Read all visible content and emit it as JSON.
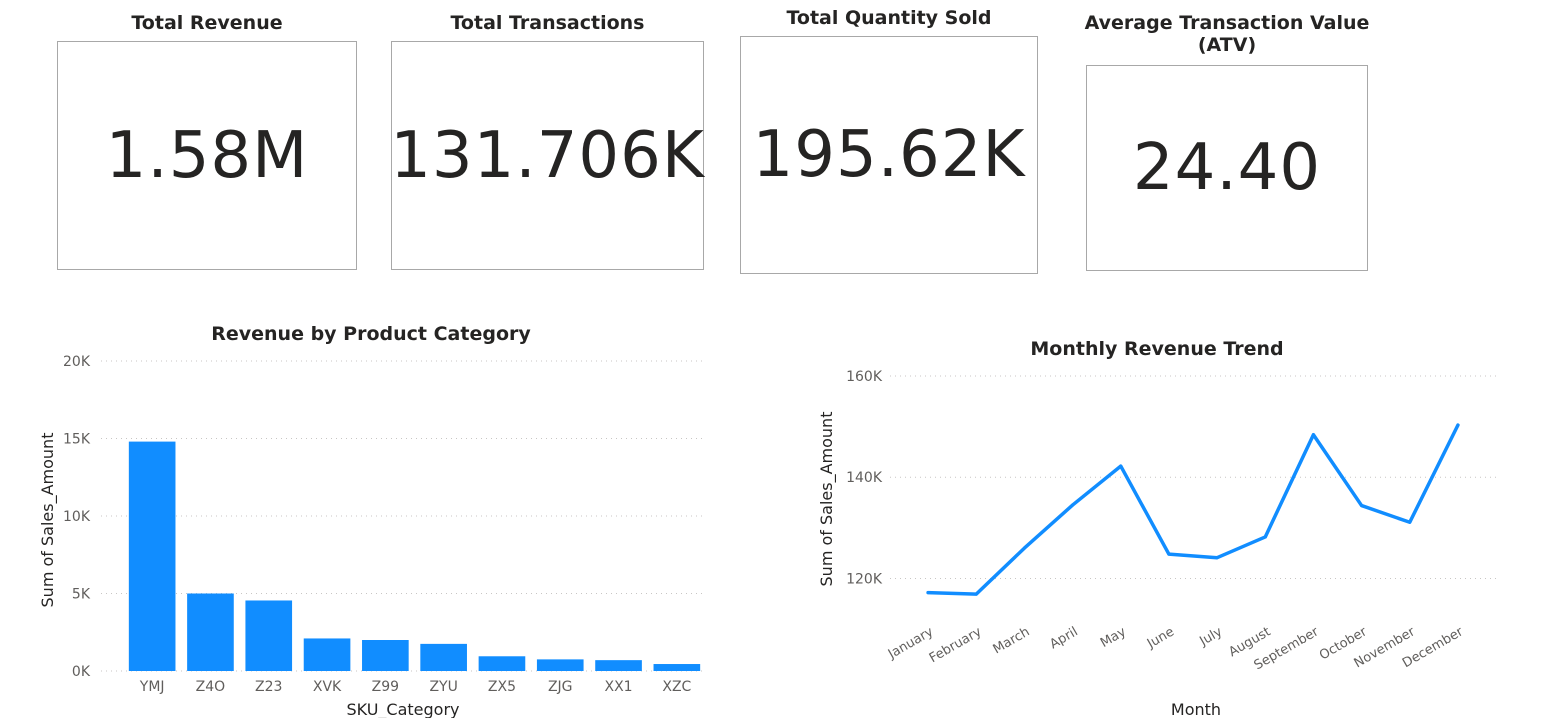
{
  "kpis": [
    {
      "title": "Total Revenue",
      "value": "1.58M"
    },
    {
      "title": "Total Transactions",
      "value": "131.706K"
    },
    {
      "title": "Total Quantity Sold",
      "value": "195.62K"
    },
    {
      "title": "Average Transaction Value\n(ATV)",
      "value": "24.40"
    }
  ],
  "colors": {
    "series": "#118DFF",
    "grid": "#c8c6c4",
    "text": "#252423",
    "axis_text": "#605e5c"
  },
  "chart_data": [
    {
      "type": "bar",
      "title": "Revenue by Product Category",
      "xlabel": "SKU_Category",
      "ylabel": "Sum of Sales_Amount",
      "categories": [
        "YMJ",
        "Z4O",
        "Z23",
        "XVK",
        "Z99",
        "ZYU",
        "ZX5",
        "ZJG",
        "XX1",
        "XZC"
      ],
      "values": [
        14800,
        5000,
        4550,
        2100,
        2000,
        1750,
        950,
        750,
        700,
        450
      ],
      "ylim": [
        0,
        20000
      ],
      "yticks": [
        0,
        5000,
        10000,
        15000,
        20000
      ],
      "ytick_labels": [
        "0K",
        "5K",
        "10K",
        "15K",
        "20K"
      ],
      "grid": true
    },
    {
      "type": "line",
      "title": "Monthly Revenue Trend",
      "xlabel": "Month",
      "ylabel": "Sum of Sales_Amount",
      "categories": [
        "January",
        "February",
        "March",
        "April",
        "May",
        "June",
        "July",
        "August",
        "September",
        "October",
        "November",
        "December"
      ],
      "values": [
        117200,
        116900,
        126000,
        134500,
        142200,
        124800,
        124100,
        128200,
        148400,
        134400,
        131100,
        150300
      ],
      "ylim": [
        111000,
        160000
      ],
      "yticks": [
        120000,
        140000,
        160000
      ],
      "ytick_labels": [
        "120K",
        "140K",
        "160K"
      ],
      "grid": true
    }
  ]
}
